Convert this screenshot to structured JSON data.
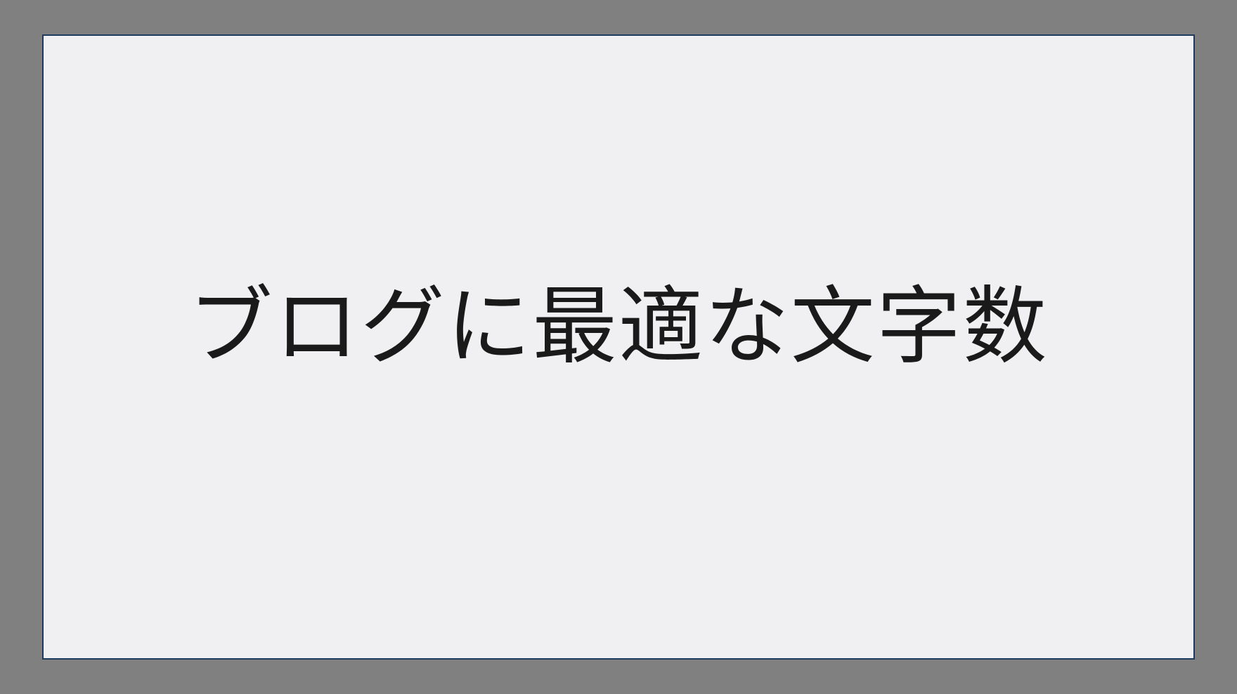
{
  "slide": {
    "title": "ブログに最適な文字数"
  }
}
